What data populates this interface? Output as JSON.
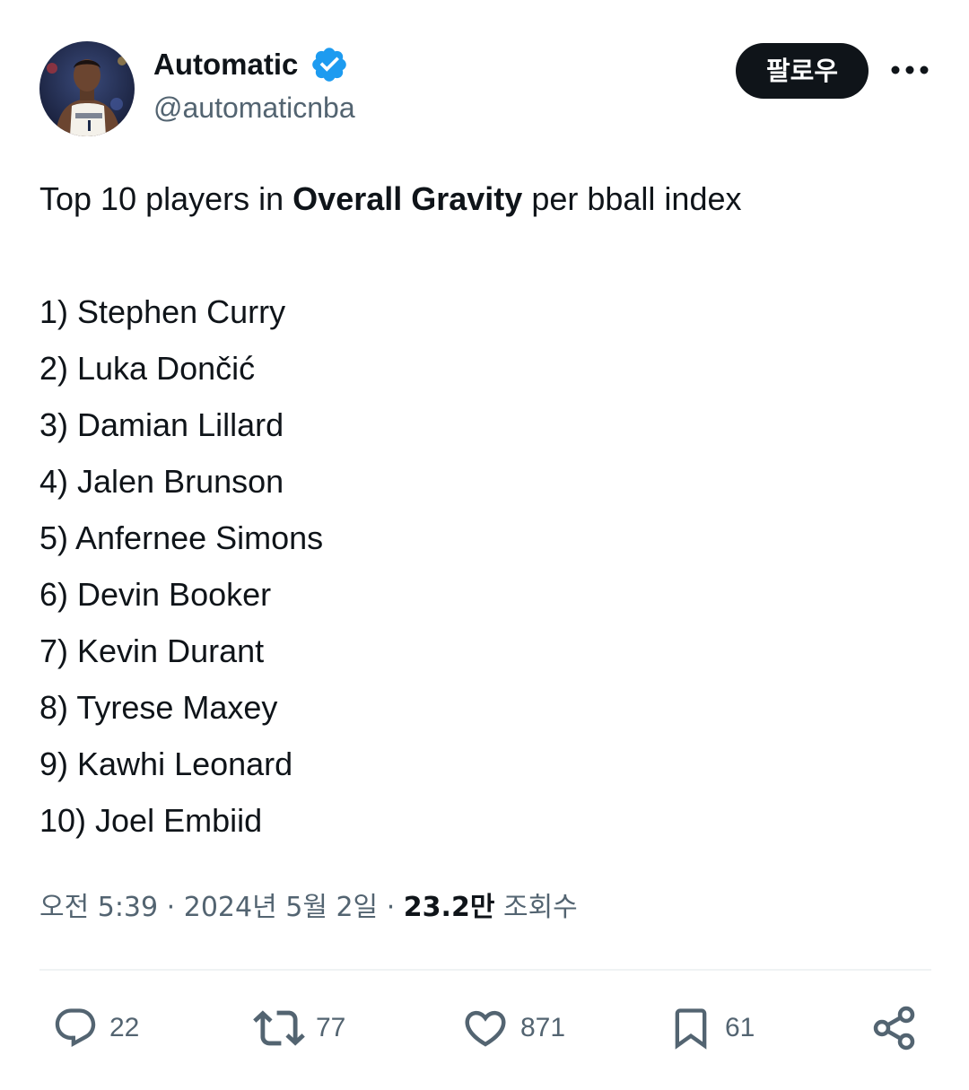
{
  "author": {
    "display_name": "Automatic",
    "handle": "@automaticnba",
    "verified": true,
    "verified_color": "#1d9bf0"
  },
  "follow_button": {
    "label": "팔로우"
  },
  "tweet": {
    "intro_prefix": "Top 10 players in ",
    "intro_bold": "Overall Gravity",
    "intro_suffix": " per bball index",
    "items": [
      "1) Stephen Curry",
      "2) Luka Dončić",
      "3) Damian Lillard",
      "4) Jalen Brunson",
      "5) Anfernee Simons",
      "6) Devin Booker",
      "7) Kevin Durant",
      "8) Tyrese Maxey",
      "9) Kawhi Leonard",
      "10) Joel Embiid"
    ]
  },
  "meta": {
    "time": "오전 5:39",
    "date": "2024년 5월 2일",
    "separator": "·",
    "views_count": "23.2만",
    "views_label": "조회수"
  },
  "actions": {
    "replies": "22",
    "reposts": "77",
    "likes": "871",
    "bookmarks": "61"
  },
  "icons": {
    "more": "more-icon",
    "reply": "reply-icon",
    "repost": "repost-icon",
    "like": "heart-icon",
    "bookmark": "bookmark-icon",
    "share": "share-icon"
  }
}
